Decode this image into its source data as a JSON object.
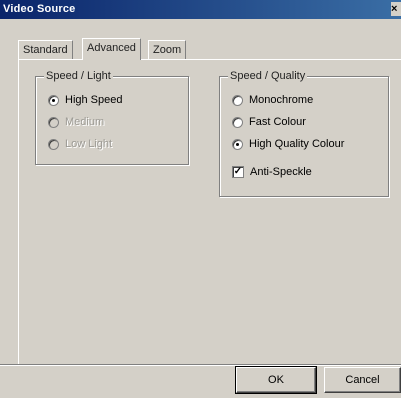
{
  "window": {
    "title": "Video Source",
    "close_glyph": "×"
  },
  "tabs": [
    {
      "label": "Standard",
      "active": false
    },
    {
      "label": "Advanced",
      "active": true
    },
    {
      "label": "Zoom",
      "active": false
    }
  ],
  "speed_light": {
    "label": "Speed / Light",
    "options": [
      {
        "label": "High Speed",
        "checked": true,
        "enabled": true
      },
      {
        "label": "Medium",
        "checked": false,
        "enabled": false
      },
      {
        "label": "Low Light",
        "checked": false,
        "enabled": false
      }
    ]
  },
  "speed_quality": {
    "label": "Speed / Quality",
    "options": [
      {
        "label": "Monochrome",
        "checked": false
      },
      {
        "label": "Fast Colour",
        "checked": false
      },
      {
        "label": "High Quality Colour",
        "checked": true
      }
    ],
    "anti_speckle": {
      "label": "Anti-Speckle",
      "checked": true,
      "mark": "✓"
    }
  },
  "buttons": {
    "ok": "OK",
    "cancel": "Cancel"
  },
  "icons": {
    "close": "close-icon",
    "radio": "radio-icon",
    "checkbox": "checkbox-icon"
  }
}
